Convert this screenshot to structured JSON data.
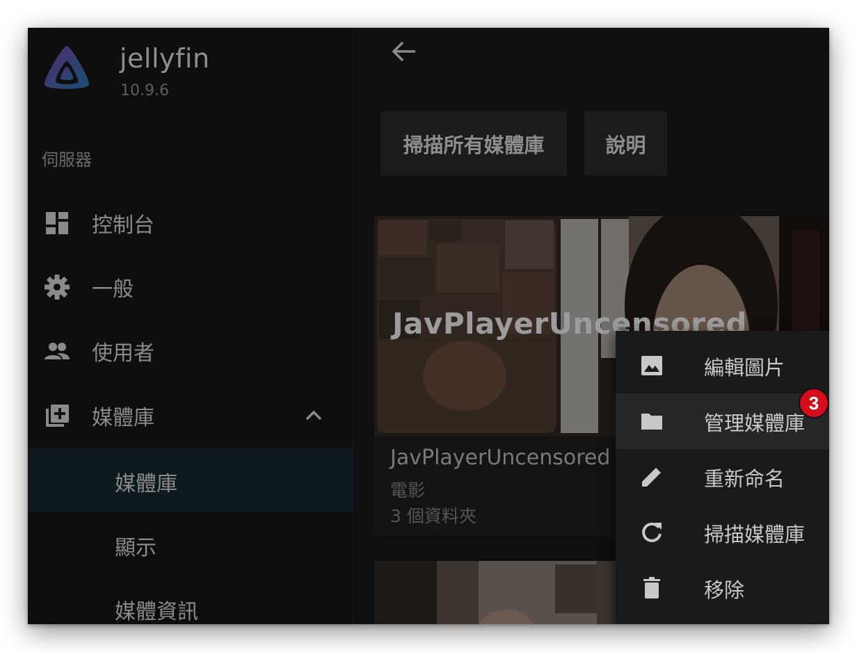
{
  "app": {
    "name": "jellyfin",
    "version": "10.9.6"
  },
  "sidebar": {
    "section_title": "伺服器",
    "items": [
      {
        "label": "控制台",
        "icon": "dashboard-icon"
      },
      {
        "label": "一般",
        "icon": "gear-icon"
      },
      {
        "label": "使用者",
        "icon": "people-icon"
      },
      {
        "label": "媒體庫",
        "icon": "library-add-icon",
        "expanded": true
      }
    ],
    "sub_items": [
      {
        "label": "媒體庫",
        "active": true
      },
      {
        "label": "顯示",
        "active": false
      },
      {
        "label": "媒體資訊",
        "active": false
      }
    ]
  },
  "toolbar": {
    "scan_all_label": "掃描所有媒體庫",
    "help_label": "說明"
  },
  "library_card": {
    "overlay_title": "JavPlayerUncensored",
    "name": "JavPlayerUncensored",
    "type": "電影",
    "folders": "3 個資料夾"
  },
  "context_menu": {
    "items": [
      {
        "label": "編輯圖片",
        "icon": "image-icon"
      },
      {
        "label": "管理媒體庫",
        "icon": "folder-icon",
        "highlighted": true
      },
      {
        "label": "重新命名",
        "icon": "pencil-icon"
      },
      {
        "label": "掃描媒體庫",
        "icon": "refresh-icon"
      },
      {
        "label": "移除",
        "icon": "trash-icon"
      }
    ]
  },
  "annotation": {
    "badge": "3",
    "color": "#d40d1c"
  },
  "colors": {
    "background": "#101010",
    "accent_logo_start": "#7b3fb5",
    "accent_logo_end": "#1e7fb8"
  }
}
